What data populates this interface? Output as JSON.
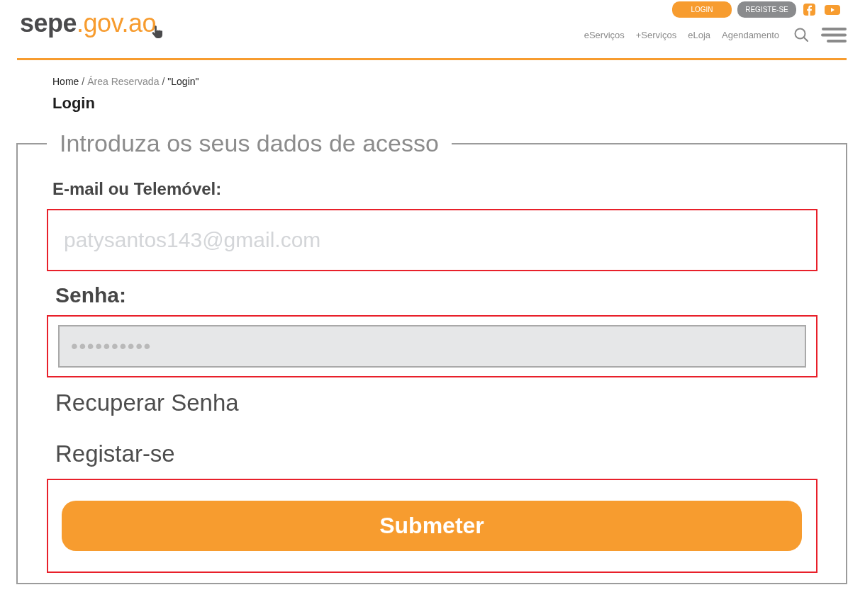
{
  "header": {
    "logo": {
      "name": "sepe",
      "domain": ".gov.ao"
    },
    "top_buttons": [
      {
        "label": "LOGIN",
        "kind": "primary"
      },
      {
        "label": "REGISTE-SE",
        "kind": "secondary"
      }
    ],
    "nav": [
      "eServiços",
      "+Serviços",
      "eLoja",
      "Agendamento"
    ]
  },
  "breadcrumb": {
    "items": [
      {
        "label": "Home",
        "muted": false
      },
      {
        "label": "Área Reservada",
        "muted": true
      },
      {
        "label": "\"Login\"",
        "muted": false
      }
    ],
    "separators": [
      "/",
      "/"
    ]
  },
  "page_title": "Login",
  "form": {
    "legend": "Introduza os seus dados de acesso",
    "fields": [
      {
        "kind": "email",
        "label": "E-mail ou Telemóvel:",
        "value": "patysantos143@gmail.com",
        "highlighted": true
      },
      {
        "kind": "password",
        "label": "Senha:",
        "value": "••••••••••",
        "highlighted": true
      }
    ],
    "links": [
      "Recuperar Senha",
      "Registar-se"
    ],
    "submit": {
      "label": "Submeter",
      "highlighted": true
    }
  }
}
